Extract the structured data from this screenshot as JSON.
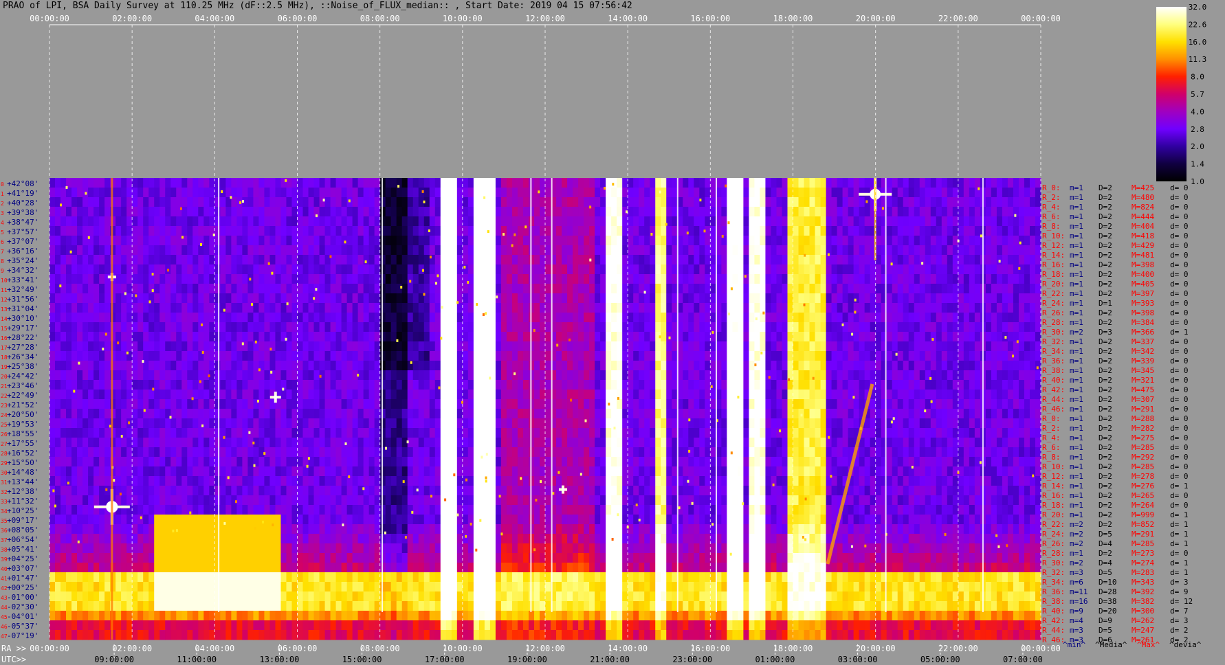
{
  "title": "PRAO of LPI, BSA Daily Survey at 110.25 MHz (dF::2.5 MHz), ::Noise_of_FLUX_median:: , Start Date: 2019 04 15 07:56:42",
  "chart_data": {
    "type": "heatmap",
    "title": "PRAO of LPI, BSA Daily Survey at 110.25 MHz (dF::2.5 MHz), ::Noise_of_FLUX_median:: , Start Date: 2019 04 15 07:56:42",
    "x_ra_ticks": [
      "00:00:00",
      "02:00:00",
      "04:00:00",
      "06:00:00",
      "08:00:00",
      "10:00:00",
      "12:00:00",
      "14:00:00",
      "16:00:00",
      "18:00:00",
      "20:00:00",
      "22:00:00",
      "00:00:00"
    ],
    "x_ra_label": "RA >>",
    "x_utc_ticks": [
      "09:00:00",
      "11:00:00",
      "13:00:00",
      "15:00:00",
      "17:00:00",
      "19:00:00",
      "21:00:00",
      "23:00:00",
      "01:00:00",
      "03:00:00",
      "05:00:00",
      "07:00:00"
    ],
    "x_utc_label": "UTC>>",
    "y_declinations": [
      "+42°08'",
      "+41°19'",
      "+40°28'",
      "+39°38'",
      "+38°47'",
      "+37°57'",
      "+37°07'",
      "+36°16'",
      "+35°24'",
      "+34°32'",
      "+33°41'",
      "+32°49'",
      "+31°56'",
      "+31°04'",
      "+30°10'",
      "+29°17'",
      "+28°22'",
      "+27°28'",
      "+26°34'",
      "+25°38'",
      "+24°42'",
      "+23°46'",
      "+22°49'",
      "+21°52'",
      "+20°50'",
      "+19°53'",
      "+18°55'",
      "+17°55'",
      "+16°52'",
      "+15°50'",
      "+14°48'",
      "+13°44'",
      "+12°38'",
      "+11°32'",
      "+10°25'",
      "+09°17'",
      "+08°05'",
      "+06°54'",
      "+05°41'",
      "+04°25'",
      "+03°07'",
      "+01°47'",
      "+00°25'",
      "-01°00'",
      "-02°30'",
      "-04°01'",
      "-05°37'",
      "-07°19'"
    ],
    "colorbar": {
      "ticks": [
        "32.0",
        "22.6",
        "16.0",
        "11.3",
        "8.0",
        "5.7",
        "4.0",
        "2.8",
        "2.0",
        "1.4",
        "1.0"
      ],
      "colors": [
        "#ffffff",
        "#ffff80",
        "#ffe000",
        "#ff9000",
        "#ff2000",
        "#d0006a",
        "#a000c0",
        "#7000ff",
        "#3000a0",
        "#100040",
        "#000000"
      ]
    },
    "row_stats": [
      {
        "r": "R_0:",
        "m": "m=1",
        "D": "D=2",
        "M": "M=425",
        "d": "d= 0"
      },
      {
        "r": "R_2:",
        "m": "m=1",
        "D": "D=2",
        "M": "M=480",
        "d": "d= 0"
      },
      {
        "r": "R_4:",
        "m": "m=1",
        "D": "D=2",
        "M": "M=824",
        "d": "d= 0"
      },
      {
        "r": "R_6:",
        "m": "m=1",
        "D": "D=2",
        "M": "M=444",
        "d": "d= 0"
      },
      {
        "r": "R_8:",
        "m": "m=1",
        "D": "D=2",
        "M": "M=404",
        "d": "d= 0"
      },
      {
        "r": "R_10:",
        "m": "m=1",
        "D": "D=2",
        "M": "M=418",
        "d": "d= 0"
      },
      {
        "r": "R_12:",
        "m": "m=1",
        "D": "D=2",
        "M": "M=429",
        "d": "d= 0"
      },
      {
        "r": "R_14:",
        "m": "m=1",
        "D": "D=2",
        "M": "M=481",
        "d": "d= 0"
      },
      {
        "r": "R_16:",
        "m": "m=1",
        "D": "D=2",
        "M": "M=398",
        "d": "d= 0"
      },
      {
        "r": "R_18:",
        "m": "m=1",
        "D": "D=2",
        "M": "M=400",
        "d": "d= 0"
      },
      {
        "r": "R_20:",
        "m": "m=1",
        "D": "D=2",
        "M": "M=405",
        "d": "d= 0"
      },
      {
        "r": "R_22:",
        "m": "m=1",
        "D": "D=2",
        "M": "M=397",
        "d": "d= 0"
      },
      {
        "r": "R_24:",
        "m": "m=1",
        "D": "D=1",
        "M": "M=393",
        "d": "d= 0"
      },
      {
        "r": "R_26:",
        "m": "m=1",
        "D": "D=2",
        "M": "M=398",
        "d": "d= 0"
      },
      {
        "r": "R_28:",
        "m": "m=1",
        "D": "D=2",
        "M": "M=384",
        "d": "d= 0"
      },
      {
        "r": "R_30:",
        "m": "m=2",
        "D": "D=3",
        "M": "M=366",
        "d": "d= 1"
      },
      {
        "r": "R_32:",
        "m": "m=1",
        "D": "D=2",
        "M": "M=337",
        "d": "d= 0"
      },
      {
        "r": "R_34:",
        "m": "m=1",
        "D": "D=2",
        "M": "M=342",
        "d": "d= 0"
      },
      {
        "r": "R_36:",
        "m": "m=1",
        "D": "D=2",
        "M": "M=339",
        "d": "d= 0"
      },
      {
        "r": "R_38:",
        "m": "m=1",
        "D": "D=2",
        "M": "M=345",
        "d": "d= 0"
      },
      {
        "r": "R_40:",
        "m": "m=1",
        "D": "D=2",
        "M": "M=321",
        "d": "d= 0"
      },
      {
        "r": "R_42:",
        "m": "m=1",
        "D": "D=2",
        "M": "M=475",
        "d": "d= 0"
      },
      {
        "r": "R_44:",
        "m": "m=1",
        "D": "D=2",
        "M": "M=307",
        "d": "d= 0"
      },
      {
        "r": "R_46:",
        "m": "m=1",
        "D": "D=2",
        "M": "M=291",
        "d": "d= 0"
      },
      {
        "r": "R_0:",
        "m": "m=1",
        "D": "D=2",
        "M": "M=288",
        "d": "d= 0"
      },
      {
        "r": "R_2:",
        "m": "m=1",
        "D": "D=2",
        "M": "M=282",
        "d": "d= 0"
      },
      {
        "r": "R_4:",
        "m": "m=1",
        "D": "D=2",
        "M": "M=275",
        "d": "d= 0"
      },
      {
        "r": "R_6:",
        "m": "m=1",
        "D": "D=2",
        "M": "M=285",
        "d": "d= 0"
      },
      {
        "r": "R_8:",
        "m": "m=1",
        "D": "D=2",
        "M": "M=292",
        "d": "d= 0"
      },
      {
        "r": "R_10:",
        "m": "m=1",
        "D": "D=2",
        "M": "M=285",
        "d": "d= 0"
      },
      {
        "r": "R_12:",
        "m": "m=1",
        "D": "D=2",
        "M": "M=278",
        "d": "d= 0"
      },
      {
        "r": "R_14:",
        "m": "m=1",
        "D": "D=2",
        "M": "M=276",
        "d": "d= 1"
      },
      {
        "r": "R_16:",
        "m": "m=1",
        "D": "D=2",
        "M": "M=265",
        "d": "d= 0"
      },
      {
        "r": "R_18:",
        "m": "m=1",
        "D": "D=2",
        "M": "M=264",
        "d": "d= 0"
      },
      {
        "r": "R_20:",
        "m": "m=1",
        "D": "D=2",
        "M": "M=999",
        "d": "d= 1"
      },
      {
        "r": "R_22:",
        "m": "m=2",
        "D": "D=2",
        "M": "M=852",
        "d": "d= 1"
      },
      {
        "r": "R_24:",
        "m": "m=2",
        "D": "D=5",
        "M": "M=291",
        "d": "d= 1"
      },
      {
        "r": "R_26:",
        "m": "m=2",
        "D": "D=4",
        "M": "M=285",
        "d": "d= 1"
      },
      {
        "r": "R_28:",
        "m": "m=1",
        "D": "D=2",
        "M": "M=273",
        "d": "d= 0"
      },
      {
        "r": "R_30:",
        "m": "m=2",
        "D": "D=4",
        "M": "M=274",
        "d": "d= 1"
      },
      {
        "r": "R_32:",
        "m": "m=3",
        "D": "D=5",
        "M": "M=283",
        "d": "d= 1"
      },
      {
        "r": "R_34:",
        "m": "m=6",
        "D": "D=10",
        "M": "M=343",
        "d": "d= 3"
      },
      {
        "r": "R_36:",
        "m": "m=11",
        "D": "D=28",
        "M": "M=392",
        "d": "d= 9"
      },
      {
        "r": "R_38:",
        "m": "m=16",
        "D": "D=38",
        "M": "M=382",
        "d": "d= 12"
      },
      {
        "r": "R_40:",
        "m": "m=9",
        "D": "D=20",
        "M": "M=300",
        "d": "d= 7"
      },
      {
        "r": "R_42:",
        "m": "m=4",
        "D": "D=9",
        "M": "M=262",
        "d": "d= 3"
      },
      {
        "r": "R_44:",
        "m": "m=3",
        "D": "D=5",
        "M": "M=247",
        "d": "d= 2"
      },
      {
        "r": "R_46:",
        "m": "m=3",
        "D": "D=6",
        "M": "M=261",
        "d": "d= 2"
      }
    ],
    "stat_legend": [
      {
        "label": "^min^",
        "color": "#000080"
      },
      {
        "label": "^Media^",
        "color": "#000000"
      },
      {
        "label": "^Max^",
        "color": "#ff0000"
      },
      {
        "label": "^devia^",
        "color": "#000000"
      }
    ],
    "colors": {
      "row_index": "#ff0000",
      "declination": "#000080",
      "stat_r": "#ff0000",
      "stat_m": "#000080",
      "stat_D": "#000000",
      "stat_M": "#ff0000",
      "stat_d": "#000000"
    }
  }
}
